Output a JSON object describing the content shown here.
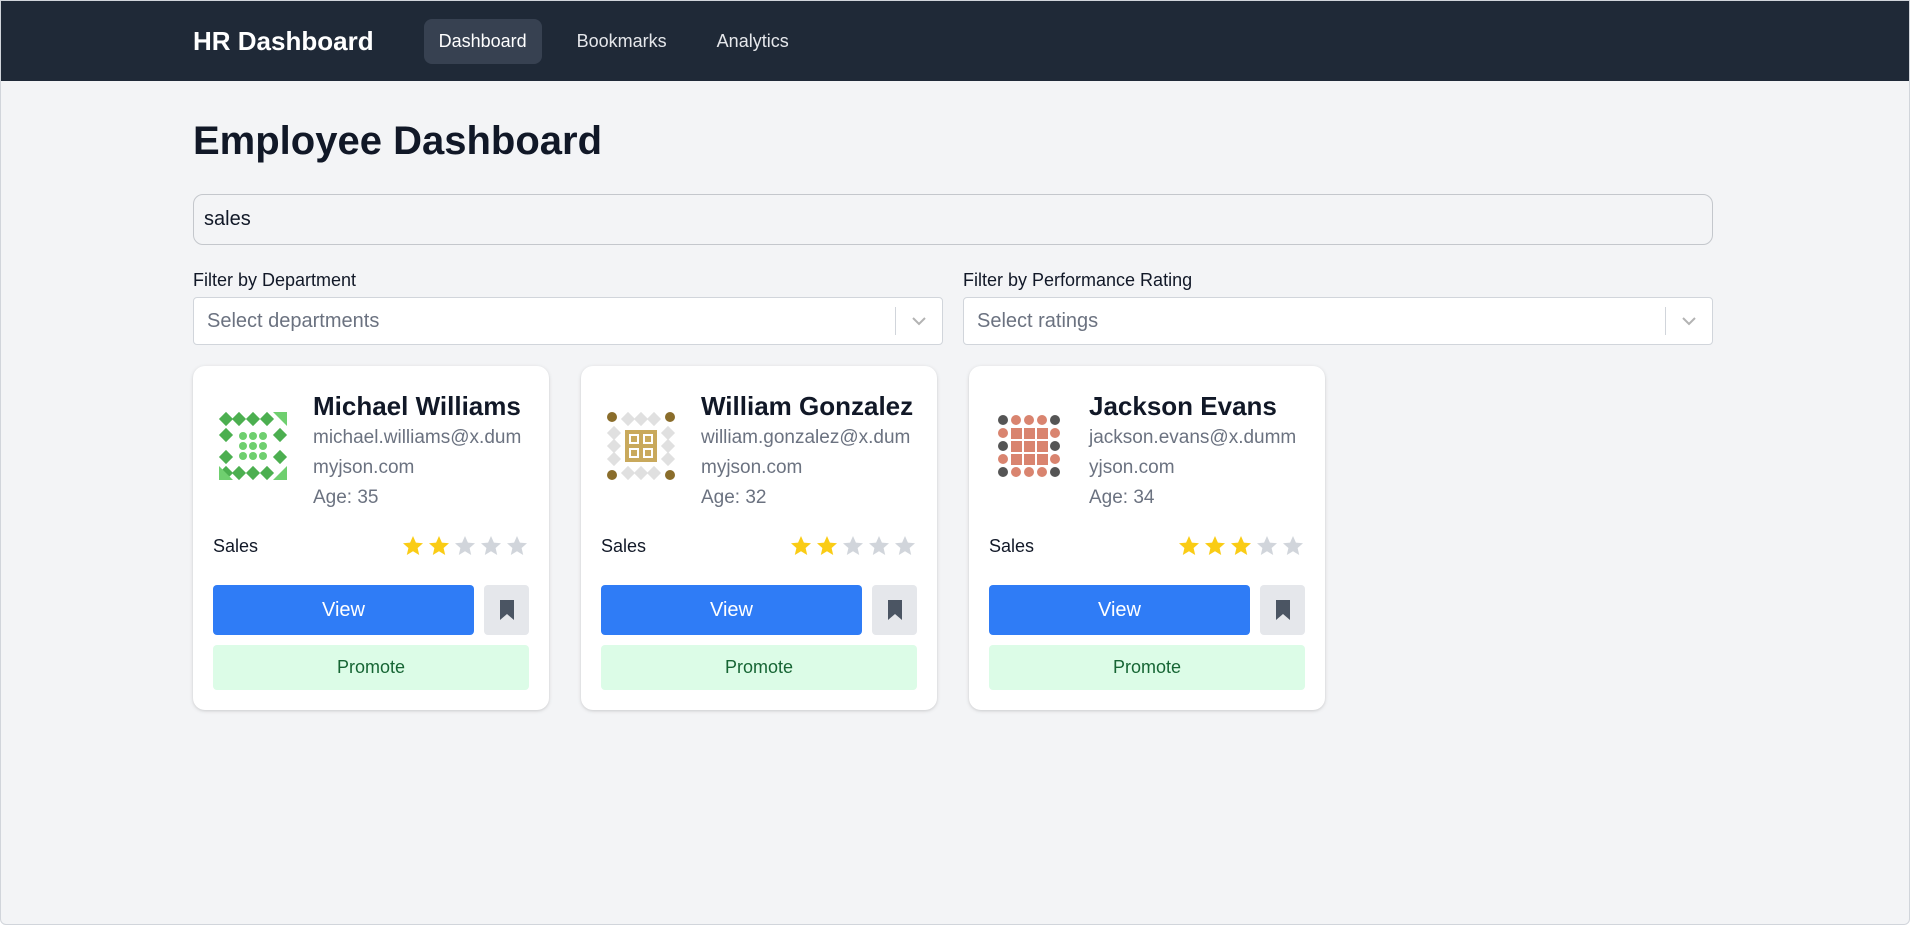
{
  "nav": {
    "brand": "HR Dashboard",
    "links": [
      "Dashboard",
      "Bookmarks",
      "Analytics"
    ],
    "active": "Dashboard"
  },
  "page": {
    "title": "Employee Dashboard"
  },
  "search": {
    "value": "sales"
  },
  "filters": {
    "department": {
      "label": "Filter by Department",
      "placeholder": "Select departments"
    },
    "rating": {
      "label": "Filter by Performance Rating",
      "placeholder": "Select ratings"
    }
  },
  "employees": [
    {
      "name": "Michael Williams",
      "email": "michael.williams@x.dummyjson.com",
      "age": "Age: 35",
      "department": "Sales",
      "rating": 2,
      "avatar_palette": [
        "#4caf50",
        "#6fcf6f"
      ]
    },
    {
      "name": "William Gonzalez",
      "email": "william.gonzalez@x.dummyjson.com",
      "age": "Age: 32",
      "department": "Sales",
      "rating": 2,
      "avatar_palette": [
        "#8a6d2b",
        "#c9a95c"
      ]
    },
    {
      "name": "Jackson Evans",
      "email": "jackson.evans@x.dummyjson.com",
      "age": "Age: 34",
      "department": "Sales",
      "rating": 3,
      "avatar_palette": [
        "#555555",
        "#d9846f"
      ]
    }
  ],
  "buttons": {
    "view": "View",
    "promote": "Promote"
  },
  "colors": {
    "navbar": "#1f2937",
    "primary": "#2f7cf6",
    "star_on": "#facc15",
    "star_off": "#d1d5db",
    "promote_bg": "#dcfce7",
    "promote_text": "#166534"
  },
  "icons": {
    "bookmark": "bookmark-icon",
    "chevron": "chevron-down-icon",
    "star": "star-icon"
  }
}
